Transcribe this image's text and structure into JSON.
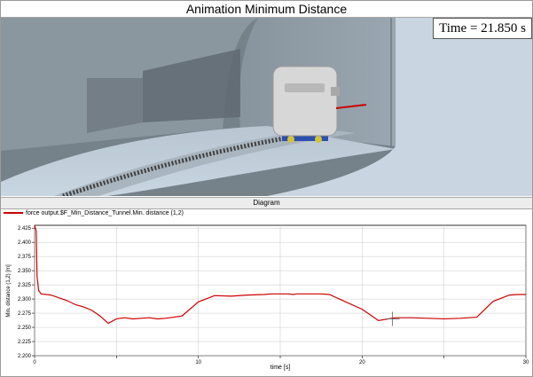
{
  "window": {
    "title": "Animation Minimum Distance",
    "time_readout": "Time = 21.850 s"
  },
  "diagram": {
    "header": "Diagram",
    "legend_label": "force output.$F_Min_Distance_Tunnel.Min. distance (1,2)"
  },
  "colors": {
    "series": "#cc0000",
    "grid": "#c8c8c8",
    "viewport_bg": "#6f7a80"
  },
  "chart_data": {
    "type": "line",
    "xlabel": "time [s]",
    "ylabel": "Min. distance (1,2) [m]",
    "xlim": [
      0,
      30
    ],
    "ylim": [
      2.2,
      2.43
    ],
    "x_ticks": [
      0,
      5,
      10,
      15,
      20,
      25,
      30
    ],
    "y_ticks": [
      2.2,
      2.225,
      2.25,
      2.275,
      2.3,
      2.325,
      2.35,
      2.375,
      2.4,
      2.425
    ],
    "x_tick_labels": [
      "0",
      "",
      "10",
      "",
      "20",
      "",
      "30"
    ],
    "y_tick_labels": [
      "2.200",
      "2.225",
      "2.250",
      "2.275",
      "2.300",
      "2.325",
      "2.350",
      "2.375",
      "2.400",
      "2.425"
    ],
    "grid": true,
    "series": [
      {
        "name": "force output.$F_Min_Distance_Tunnel.Min. distance (1,2)",
        "x": [
          0,
          0.1,
          0.15,
          0.25,
          0.4,
          1.0,
          1.5,
          2.0,
          2.5,
          3.0,
          3.5,
          4.0,
          4.5,
          5.0,
          5.5,
          6.0,
          6.5,
          7.0,
          7.5,
          8.0,
          8.5,
          9.0,
          10.0,
          11.0,
          12.0,
          13.0,
          14.0,
          14.5,
          15.0,
          15.5,
          15.8,
          16.0,
          16.5,
          17.0,
          17.5,
          18.0,
          19.0,
          20.0,
          21.0,
          22.0,
          23.0,
          24.0,
          25.0,
          26.0,
          27.0,
          28.0,
          29.0,
          29.5,
          30.0
        ],
        "y": [
          2.43,
          2.42,
          2.34,
          2.315,
          2.309,
          2.307,
          2.302,
          2.297,
          2.29,
          2.286,
          2.28,
          2.27,
          2.257,
          2.265,
          2.267,
          2.265,
          2.266,
          2.267,
          2.265,
          2.266,
          2.268,
          2.27,
          2.295,
          2.306,
          2.305,
          2.307,
          2.308,
          2.309,
          2.309,
          2.309,
          2.308,
          2.309,
          2.309,
          2.309,
          2.309,
          2.308,
          2.295,
          2.282,
          2.262,
          2.267,
          2.267,
          2.266,
          2.265,
          2.266,
          2.268,
          2.296,
          2.307,
          2.308,
          2.308
        ]
      }
    ],
    "cursor_x": 21.85
  }
}
